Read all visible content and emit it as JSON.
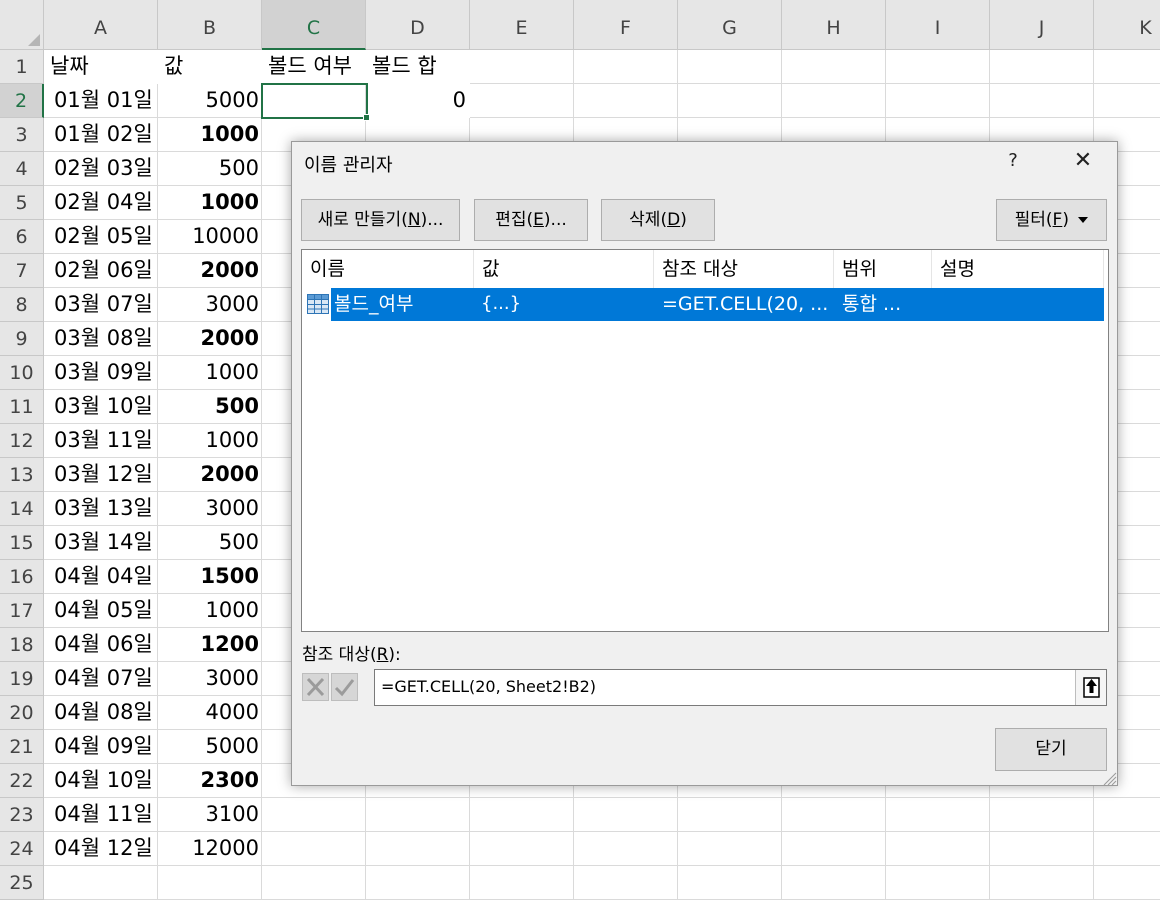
{
  "sheet": {
    "columns": [
      "A",
      "B",
      "C",
      "D",
      "E",
      "F",
      "G",
      "H",
      "I",
      "J",
      "K"
    ],
    "rows": [
      "1",
      "2",
      "3",
      "4",
      "5",
      "6",
      "7",
      "8",
      "9",
      "10",
      "11",
      "12",
      "13",
      "14",
      "15",
      "16",
      "17",
      "18",
      "19",
      "20",
      "21",
      "22",
      "23",
      "24",
      "25"
    ],
    "header_row": {
      "a": "날짜",
      "b": "값",
      "c": "볼드 여부",
      "d": "볼드 합"
    },
    "d2_value": "0",
    "data": [
      {
        "date": "01월 01일",
        "value": "5000",
        "bold": false
      },
      {
        "date": "01월 02일",
        "value": "1000",
        "bold": true
      },
      {
        "date": "02월 03일",
        "value": "500",
        "bold": false
      },
      {
        "date": "02월 04일",
        "value": "1000",
        "bold": true
      },
      {
        "date": "02월 05일",
        "value": "10000",
        "bold": false
      },
      {
        "date": "02월 06일",
        "value": "2000",
        "bold": true
      },
      {
        "date": "03월 07일",
        "value": "3000",
        "bold": false
      },
      {
        "date": "03월 08일",
        "value": "2000",
        "bold": true
      },
      {
        "date": "03월 09일",
        "value": "1000",
        "bold": false
      },
      {
        "date": "03월 10일",
        "value": "500",
        "bold": true
      },
      {
        "date": "03월 11일",
        "value": "1000",
        "bold": false
      },
      {
        "date": "03월 12일",
        "value": "2000",
        "bold": true
      },
      {
        "date": "03월 13일",
        "value": "3000",
        "bold": false
      },
      {
        "date": "03월 14일",
        "value": "500",
        "bold": false
      },
      {
        "date": "04월 04일",
        "value": "1500",
        "bold": true
      },
      {
        "date": "04월 05일",
        "value": "1000",
        "bold": false
      },
      {
        "date": "04월 06일",
        "value": "1200",
        "bold": true
      },
      {
        "date": "04월 07일",
        "value": "3000",
        "bold": false
      },
      {
        "date": "04월 08일",
        "value": "4000",
        "bold": false
      },
      {
        "date": "04월 09일",
        "value": "5000",
        "bold": false
      },
      {
        "date": "04월 10일",
        "value": "2300",
        "bold": true
      },
      {
        "date": "04월 11일",
        "value": "3100",
        "bold": false
      },
      {
        "date": "04월 12일",
        "value": "12000",
        "bold": false
      }
    ],
    "selected_cell": "C2",
    "accent_color": "#217346"
  },
  "dialog": {
    "title": "이름 관리자",
    "help_label": "?",
    "close_label": "✕",
    "new_button": {
      "text": "새로 만들기(",
      "key": "N",
      "suffix": ")..."
    },
    "edit_button": {
      "text": "편집(",
      "key": "E",
      "suffix": ")..."
    },
    "delete_button": {
      "text": "삭제(",
      "key": "D",
      "suffix": ")"
    },
    "filter_button": {
      "text": "필터(",
      "key": "F",
      "suffix": ")"
    },
    "list_columns": {
      "name": "이름",
      "value": "값",
      "refers_to": "참조 대상",
      "scope": "범위",
      "comment": "설명"
    },
    "selected_item": {
      "name": "볼드_여부",
      "value": "{...}",
      "refers_to": "=GET.CELL(20, ...",
      "scope": "통합 ...",
      "comment": ""
    },
    "refers_label": {
      "text": "참조 대상(",
      "key": "R",
      "suffix": "):"
    },
    "refers_value": "=GET.CELL(20, Sheet2!B2)",
    "close_button": "닫기",
    "selection_color": "#0078d7"
  }
}
